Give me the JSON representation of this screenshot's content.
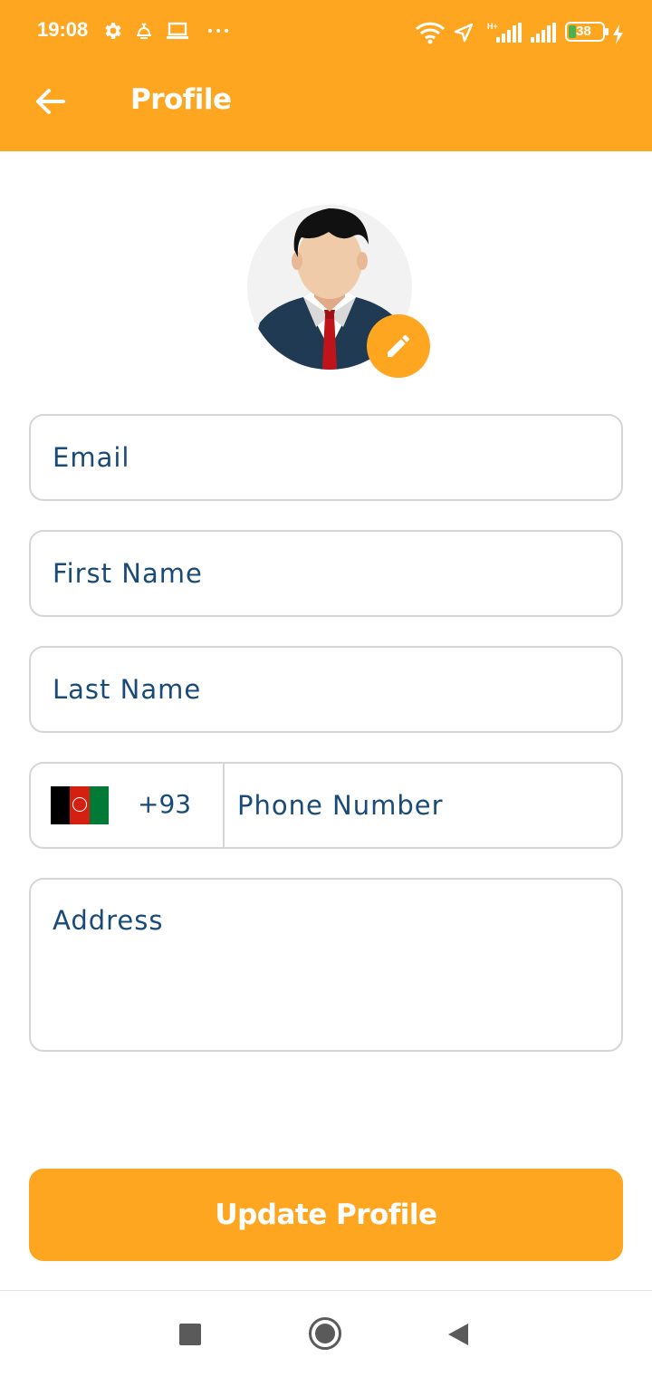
{
  "status_bar": {
    "time": "19:08",
    "battery": "38",
    "icons": [
      "gear-icon",
      "bell-icon",
      "laptop-icon",
      "more-icon",
      "wifi-icon",
      "location-icon",
      "signal-icon",
      "battery-icon",
      "charging-icon"
    ]
  },
  "app_bar": {
    "title": "Profile",
    "back_icon": "arrow-back-icon",
    "background": "#FFA620"
  },
  "avatar": {
    "edit_icon": "pencil-icon"
  },
  "form": {
    "email_placeholder": "Email",
    "first_name_placeholder": "First Name",
    "last_name_placeholder": "Last Name",
    "phone": {
      "country_flag": "afghanistan-flag-icon",
      "dial_code": "+93",
      "placeholder": "Phone Number"
    },
    "address_placeholder": "Address"
  },
  "actions": {
    "update_label": "Update Profile"
  },
  "nav_bar": {
    "icons": [
      "recents-icon",
      "home-icon",
      "back-icon"
    ]
  },
  "colors": {
    "accent": "#FFA620",
    "field_text": "#1a4a78",
    "field_border": "#d6d6d6"
  }
}
